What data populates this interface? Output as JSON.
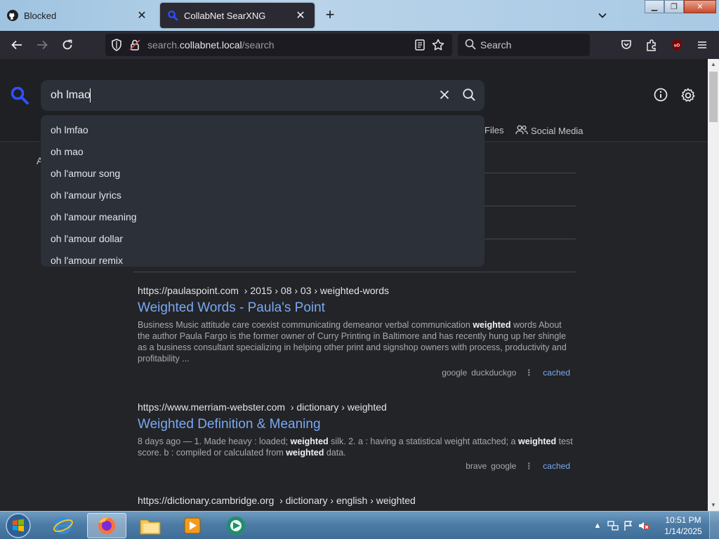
{
  "browser": {
    "tabs": [
      {
        "label": "Blocked",
        "icon": "github-icon",
        "active": false
      },
      {
        "label": "CollabNet SearXNG",
        "icon": "searxng-icon",
        "active": true
      }
    ],
    "url": {
      "prefix": "search.",
      "host": "collabnet.local",
      "path": "/search"
    },
    "search_placeholder": "Search"
  },
  "search": {
    "query": "oh lmao",
    "suggestions": [
      "oh lmfao",
      "oh mao",
      "oh l'amour song",
      "oh l'amour lyrics",
      "oh l'amour meaning",
      "oh l'amour dollar",
      "oh l'amour remix"
    ]
  },
  "categories": {
    "files_partial": "Files",
    "social": "Social Media"
  },
  "stub_text": "A",
  "results": [
    {
      "domain": "https://paulaspoint.com",
      "path": "› 2015 › 08 › 03 › weighted-words",
      "title": "Weighted Words - Paula's Point",
      "snippet_html": "Business Music attitude care coexist communicating demeanor verbal communication <b>weighted</b> words About the author Paula Fargo is the former owner of Curry Printing in Baltimore and has recently hung up her shingle as a business consultant specializing in helping other print and signshop owners with process, productivity and profitability ...",
      "engines": [
        "google",
        "duckduckgo"
      ],
      "cached": "cached"
    },
    {
      "domain": "https://www.merriam-webster.com",
      "path": "› dictionary › weighted",
      "title": "Weighted Definition & Meaning",
      "snippet_html": "8 days ago — 1. Made heavy : loaded; <b>weighted</b> silk. 2. a : having a statistical weight attached; a <b>weighted</b> test score. b : compiled or calculated from <b>weighted</b> data.",
      "engines": [
        "brave",
        "google"
      ],
      "cached": "cached"
    },
    {
      "domain": "https://dictionary.cambridge.org",
      "path": "› dictionary › english › weighted",
      "title": "",
      "snippet_html": "",
      "engines": [],
      "cached": ""
    }
  ],
  "taskbar": {
    "time": "10:51 PM",
    "date": "1/14/2025",
    "apps": [
      "internet-explorer",
      "firefox",
      "file-explorer",
      "media-player",
      "remote-app"
    ]
  },
  "colors": {
    "page_bg": "#222428",
    "input_bg": "#2c3038",
    "link": "#7aa8f2",
    "logo_accent": "#3050ff"
  }
}
